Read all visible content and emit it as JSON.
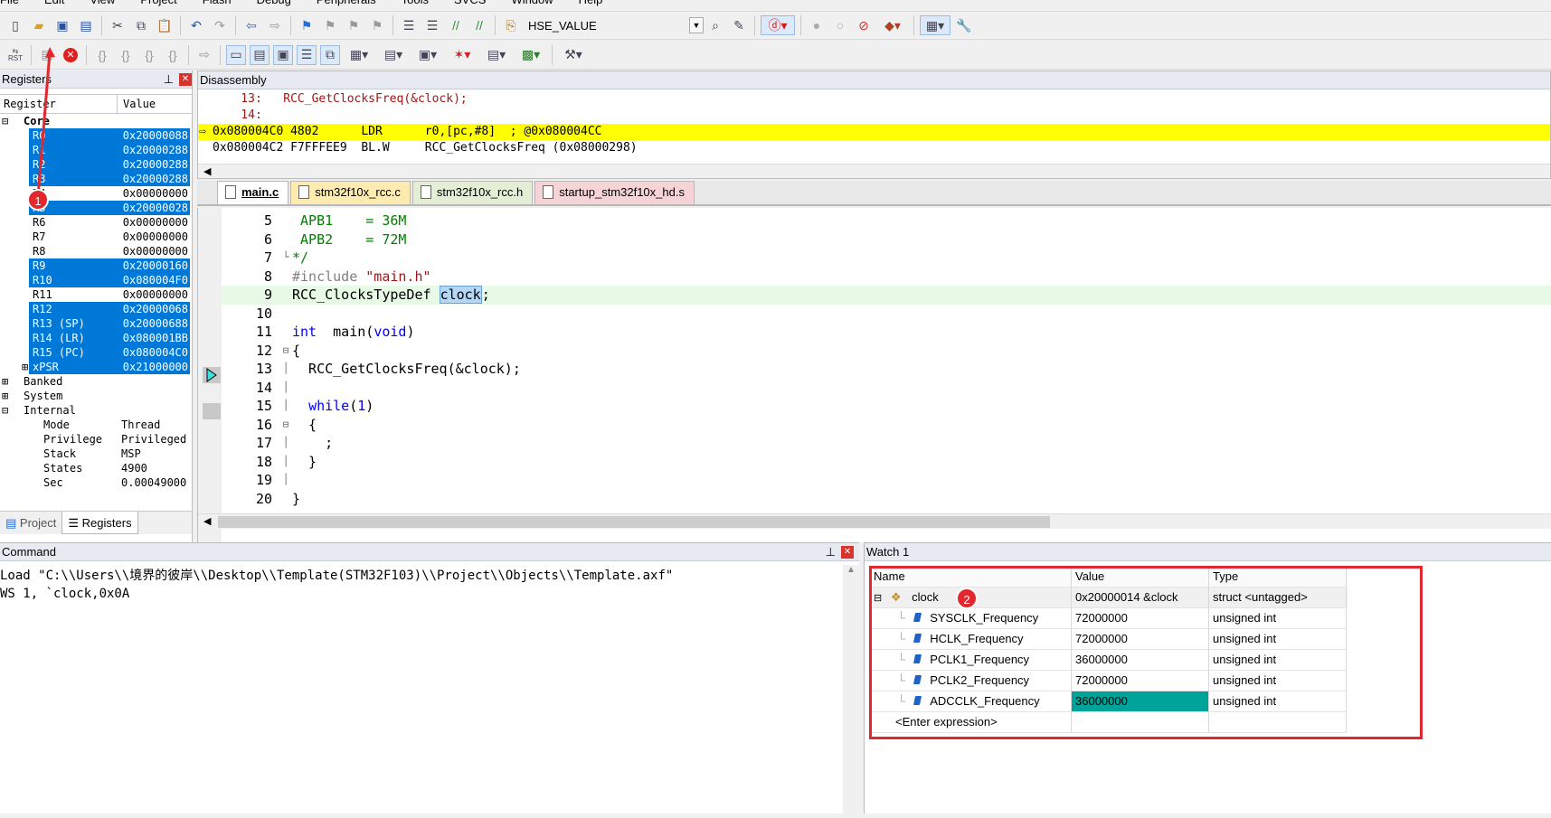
{
  "menu": [
    "File",
    "Edit",
    "View",
    "Project",
    "Flash",
    "Debug",
    "Peripherals",
    "Tools",
    "SVCS",
    "Window",
    "Help"
  ],
  "toolbar": {
    "target_combo": "HSE_VALUE",
    "rst_label": "RST"
  },
  "registers": {
    "title": "Registers",
    "col_register": "Register",
    "col_value": "Value",
    "core_label": "Core",
    "core_rows": [
      {
        "name": "R0",
        "value": "0x20000088",
        "hl": true
      },
      {
        "name": "R1",
        "value": "0x20000288",
        "hl": true
      },
      {
        "name": "R2",
        "value": "0x20000288",
        "hl": true
      },
      {
        "name": "R3",
        "value": "0x20000288",
        "hl": true
      },
      {
        "name": "R4",
        "value": "0x00000000",
        "hl": false
      },
      {
        "name": "R5",
        "value": "0x20000028",
        "hl": true
      },
      {
        "name": "R6",
        "value": "0x00000000",
        "hl": false
      },
      {
        "name": "R7",
        "value": "0x00000000",
        "hl": false
      },
      {
        "name": "R8",
        "value": "0x00000000",
        "hl": false
      },
      {
        "name": "R9",
        "value": "0x20000160",
        "hl": true
      },
      {
        "name": "R10",
        "value": "0x080004F0",
        "hl": true
      },
      {
        "name": "R11",
        "value": "0x00000000",
        "hl": false
      },
      {
        "name": "R12",
        "value": "0x20000068",
        "hl": true
      },
      {
        "name": "R13 (SP)",
        "value": "0x20000688",
        "hl": true
      },
      {
        "name": "R14 (LR)",
        "value": "0x080001BB",
        "hl": true
      },
      {
        "name": "R15 (PC)",
        "value": "0x080004C0",
        "hl": true
      },
      {
        "name": "xPSR",
        "value": "0x21000000",
        "hl": true
      }
    ],
    "banked": "Banked",
    "system": "System",
    "internal": "Internal",
    "internal_rows": [
      {
        "name": "Mode",
        "value": "Thread"
      },
      {
        "name": "Privilege",
        "value": "Privileged"
      },
      {
        "name": "Stack",
        "value": "MSP"
      },
      {
        "name": "States",
        "value": "4900"
      },
      {
        "name": "Sec",
        "value": "0.00049000"
      }
    ],
    "tab_project": "Project",
    "tab_registers": "Registers"
  },
  "disassembly": {
    "title": "Disassembly",
    "lines": [
      {
        "text": "    13:   RCC_GetClocksFreq(&clock);",
        "kind": "src"
      },
      {
        "text": "    14:",
        "kind": "src"
      },
      {
        "text": "0x080004C0 4802      LDR      r0,[pc,#8]  ; @0x080004CC",
        "kind": "current"
      },
      {
        "text": "0x080004C2 F7FFFEE9  BL.W     RCC_GetClocksFreq (0x08000298)",
        "kind": "asm"
      }
    ]
  },
  "editor": {
    "tabs": [
      {
        "label": "main.c",
        "color": "#ffffff",
        "active": true
      },
      {
        "label": "stm32f10x_rcc.c",
        "color": "#fdebb0",
        "active": false
      },
      {
        "label": "stm32f10x_rcc.h",
        "color": "#e3eed5",
        "active": false
      },
      {
        "label": "startup_stm32f10x_hd.s",
        "color": "#f6d3d7",
        "active": false
      }
    ],
    "lines": [
      {
        "n": "5",
        "text": " APB1    = 36M"
      },
      {
        "n": "6",
        "text": " APB2    = 72M"
      },
      {
        "n": "7",
        "text": "*/"
      },
      {
        "n": "8",
        "text": "#include \"main.h\""
      },
      {
        "n": "9",
        "text": "RCC_ClocksTypeDef clock;"
      },
      {
        "n": "10",
        "text": ""
      },
      {
        "n": "11",
        "text": "int  main(void)"
      },
      {
        "n": "12",
        "text": "{"
      },
      {
        "n": "13",
        "text": "  RCC_GetClocksFreq(&clock);"
      },
      {
        "n": "14",
        "text": ""
      },
      {
        "n": "15",
        "text": "  while(1)"
      },
      {
        "n": "16",
        "text": "  {"
      },
      {
        "n": "17",
        "text": "    ;"
      },
      {
        "n": "18",
        "text": "  }"
      },
      {
        "n": "19",
        "text": ""
      },
      {
        "n": "20",
        "text": "}"
      }
    ]
  },
  "command": {
    "title": "Command",
    "lines": [
      "Load \"C:\\\\Users\\\\境界的彼岸\\\\Desktop\\\\Template(STM32F103)\\\\Project\\\\Objects\\\\Template.axf\"",
      "WS 1, `clock,0x0A"
    ]
  },
  "watch": {
    "title": "Watch 1",
    "col_name": "Name",
    "col_value": "Value",
    "col_type": "Type",
    "root": {
      "name": "clock",
      "value": "0x20000014 &clock",
      "type": "struct <untagged>"
    },
    "members": [
      {
        "name": "SYSCLK_Frequency",
        "value": "72000000",
        "type": "unsigned int",
        "changed": false
      },
      {
        "name": "HCLK_Frequency",
        "value": "72000000",
        "type": "unsigned int",
        "changed": false
      },
      {
        "name": "PCLK1_Frequency",
        "value": "36000000",
        "type": "unsigned int",
        "changed": false
      },
      {
        "name": "PCLK2_Frequency",
        "value": "72000000",
        "type": "unsigned int",
        "changed": false
      },
      {
        "name": "ADCCLK_Frequency",
        "value": "36000000",
        "type": "unsigned int",
        "changed": true
      }
    ],
    "enter_expression": "<Enter expression>"
  },
  "annotations": {
    "badge1": "1",
    "badge2": "2",
    "accent": "#e0282e"
  }
}
